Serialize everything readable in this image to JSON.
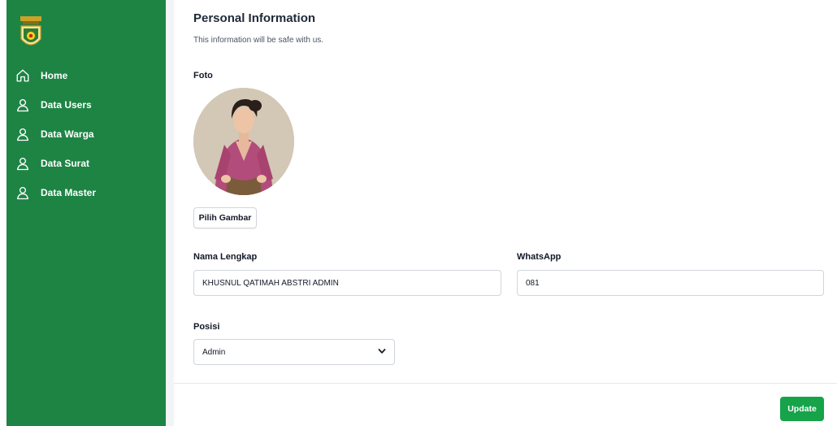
{
  "sidebar": {
    "logo_icon": "regional-emblem-logo",
    "items": [
      {
        "label": "Home",
        "icon": "home-icon"
      },
      {
        "label": "Data Users",
        "icon": "user-icon"
      },
      {
        "label": "Data Warga",
        "icon": "user-icon"
      },
      {
        "label": "Data Surat",
        "icon": "user-icon"
      },
      {
        "label": "Data Master",
        "icon": "user-icon"
      }
    ]
  },
  "header": {
    "title": "Personal Information",
    "subtitle": "This information will be safe with us."
  },
  "photo": {
    "label": "Foto",
    "pick_label": "Pilih Gambar"
  },
  "form": {
    "full_name": {
      "label": "Nama Lengkap",
      "value": "KHUSNUL QATIMAH ABSTRI ADMIN"
    },
    "whatsapp": {
      "label": "WhatsApp",
      "value": "081"
    },
    "position": {
      "label": "Posisi",
      "selected": "Admin"
    }
  },
  "footer": {
    "update_label": "Update"
  },
  "colors": {
    "sidebar_bg": "#1d8444",
    "primary_button": "#16a34a"
  }
}
